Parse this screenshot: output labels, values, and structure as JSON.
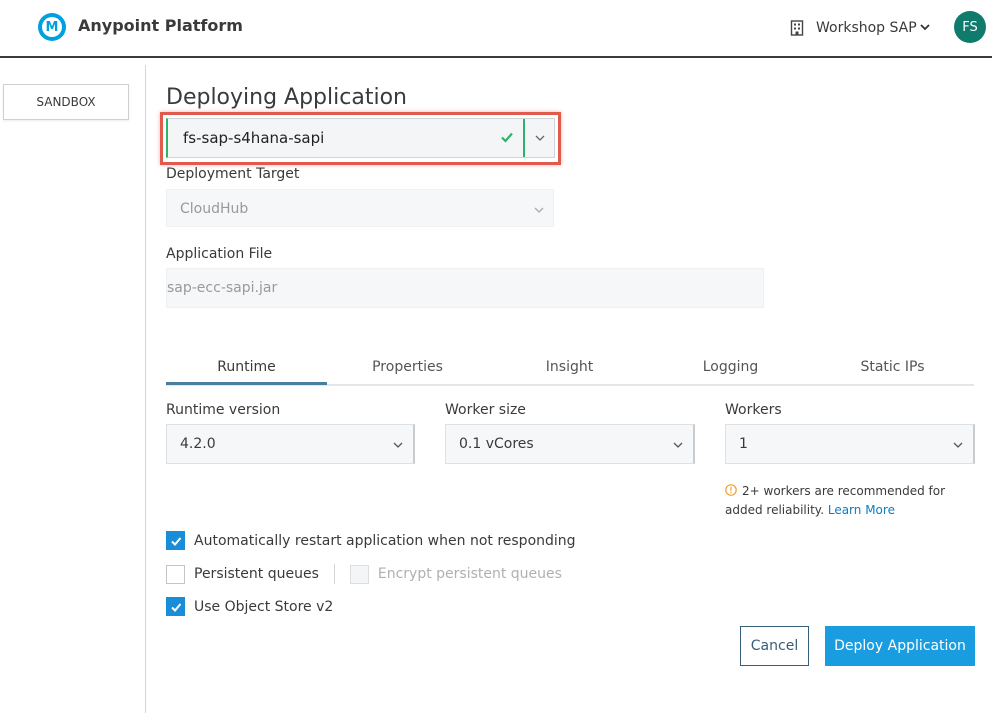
{
  "header": {
    "app_title": "Anypoint Platform",
    "logo_letter": "M",
    "org_name": "Workshop SAP",
    "avatar_initials": "FS"
  },
  "sidebar": {
    "environment": "SANDBOX"
  },
  "main": {
    "page_title": "Deploying Application",
    "app_name": "fs-sap-s4hana-sapi",
    "deployment_target": {
      "label": "Deployment Target",
      "value": "CloudHub"
    },
    "application_file": {
      "label": "Application File",
      "value": "sap-ecc-sapi.jar"
    },
    "tabs": [
      {
        "label": "Runtime",
        "active": true
      },
      {
        "label": "Properties",
        "active": false
      },
      {
        "label": "Insight",
        "active": false
      },
      {
        "label": "Logging",
        "active": false
      },
      {
        "label": "Static IPs",
        "active": false
      }
    ],
    "runtime": {
      "version_label": "Runtime version",
      "version_value": "4.2.0",
      "worker_size_label": "Worker size",
      "worker_size_value": "0.1 vCores",
      "workers_label": "Workers",
      "workers_value": "1",
      "workers_warning": "2+ workers are recommended for added reliability.",
      "learn_more": "Learn More"
    },
    "options": {
      "auto_restart": {
        "label": "Automatically restart application when not responding",
        "checked": true
      },
      "persistent_queues": {
        "label": "Persistent queues",
        "checked": false
      },
      "encrypt_queues": {
        "label": "Encrypt persistent queues",
        "checked": false,
        "disabled": true
      },
      "object_store_v2": {
        "label": "Use Object Store v2",
        "checked": true
      }
    },
    "actions": {
      "cancel": "Cancel",
      "deploy": "Deploy Application"
    }
  },
  "colors": {
    "accent": "#1a9de0",
    "valid_green": "#2fb36b",
    "highlight_red": "#e05a4e",
    "warning_orange": "#f0a030",
    "avatar_bg": "#0f7b6c"
  }
}
